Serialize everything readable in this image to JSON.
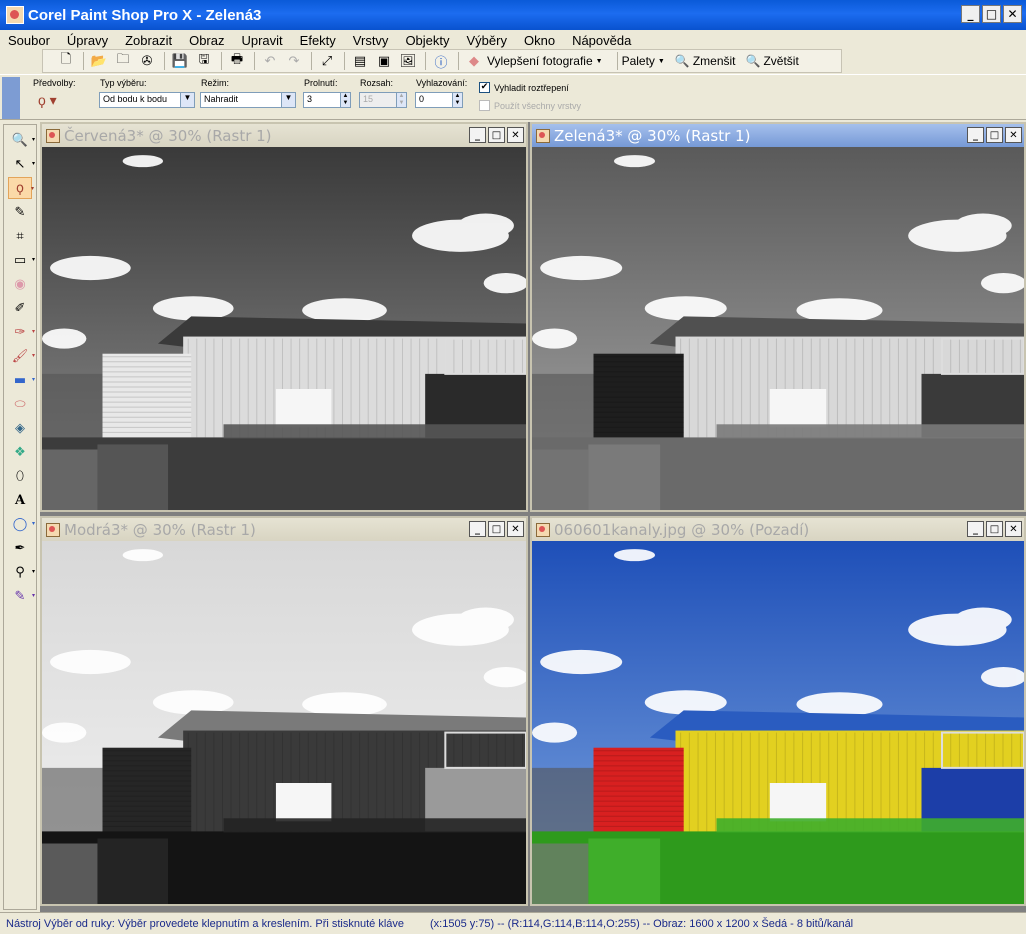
{
  "app": {
    "title": "Corel Paint Shop Pro X - Zelená3"
  },
  "menu": [
    "Soubor",
    "Úpravy",
    "Zobrazit",
    "Obraz",
    "Upravit",
    "Efekty",
    "Vrstvy",
    "Objekty",
    "Výběry",
    "Okno",
    "Nápověda"
  ],
  "toolbar": {
    "enhance_label": "Vylepšení fotografie",
    "palettes_label": "Palety",
    "zoom_out_label": "Zmenšit",
    "zoom_in_label": "Zvětšit"
  },
  "options": {
    "presets_label": "Předvolby:",
    "selection_type_label": "Typ výběru:",
    "selection_type_value": "Od bodu k bodu",
    "mode_label": "Režim:",
    "mode_value": "Nahradit",
    "feather_label": "Prolnutí:",
    "feather_value": "3",
    "range_label": "Rozsah:",
    "range_value": "15",
    "smoothing_label": "Vyhlazování:",
    "smoothing_value": "0",
    "antialias_label": "Vyhladit roztřepení",
    "all_layers_label": "Použít všechny vrstvy"
  },
  "documents": [
    {
      "title": "Červená3* @  30% (Rastr 1)",
      "active": false,
      "variant": "red"
    },
    {
      "title": "Zelená3* @  30% (Rastr 1)",
      "active": true,
      "variant": "green"
    },
    {
      "title": "Modrá3* @  30% (Rastr 1)",
      "active": false,
      "variant": "blue"
    },
    {
      "title": "060601kanaly.jpg @  30% (Pozadí)",
      "active": false,
      "variant": "color"
    }
  ],
  "status": {
    "message": "Nástroj Výběr od ruky: Výběr provedete klepnutím a kreslením. Při stisknuté kláve",
    "coords": "(x:1505 y:75) -- (R:114,G:114,B:114,O:255) -- Obraz:  1600 x 1200 x Šedá - 8 bitů/kanál"
  },
  "colors": {
    "accent": "#0a5ad8",
    "status_text": "#1a2a8a"
  },
  "icons": [
    "zoom-icon",
    "pick-icon",
    "freehand-selection-icon",
    "dropper-icon",
    "crop-icon",
    "straighten-icon",
    "redeye-icon",
    "clone-icon",
    "scratch-remover-icon",
    "paint-brush-icon",
    "lighten-darken-icon",
    "eraser-icon",
    "fill-icon",
    "picture-tube-icon",
    "retouch-icon",
    "text-icon",
    "preset-shape-icon",
    "pen-icon",
    "warp-brush-icon",
    "art-media-icon"
  ]
}
